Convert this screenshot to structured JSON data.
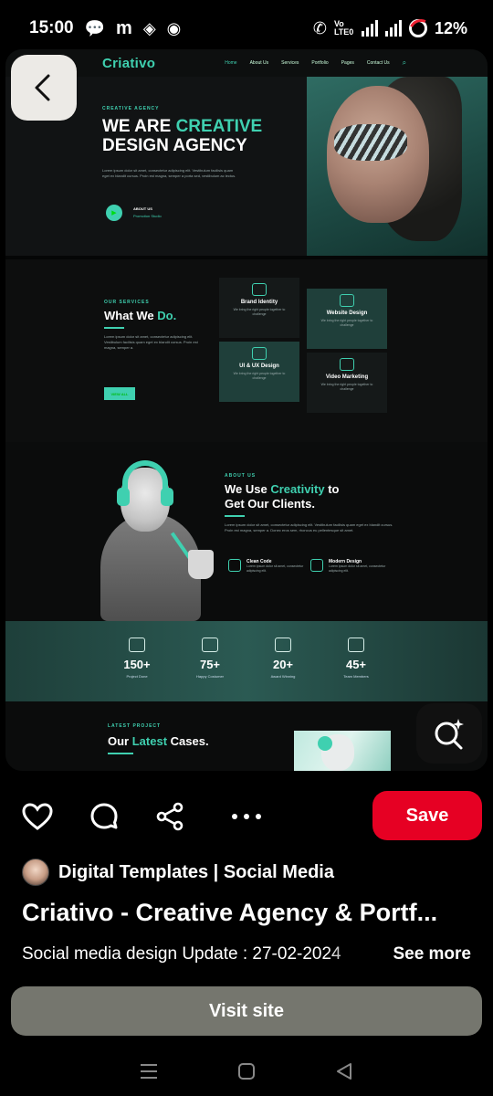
{
  "status_bar": {
    "time": "15:00",
    "left_icons": [
      "chat-bubble-icon",
      "m-icon",
      "discord-icon",
      "whatsapp-icon"
    ],
    "network_label": "Vo LTE0",
    "battery": "12%"
  },
  "pin": {
    "site": {
      "logo": "Criativo",
      "nav_links": [
        "Home",
        "About Us",
        "Services",
        "Portfolio",
        "Pages",
        "Contact Us"
      ],
      "hero": {
        "eyebrow": "CREATIVE AGENCY",
        "title_line1": "WE ARE ",
        "title_accent": "CREATIVE",
        "title_line2": "DESIGN AGENCY",
        "body": "Lorem ipsum dolor sit amet, consectetur adipiscing elit. Vestibulum facilisis quam eget ex blandit cursus. Proin est magna, semper a porta sed, vestibulum ac lectus.",
        "about_label": "ABOUT US",
        "promo_label": "Promotion Studio"
      },
      "services": {
        "eyebrow": "OUR SERVICES",
        "title": "What We ",
        "title_accent": "Do.",
        "body": "Lorem ipsum dolor sit amet, consectetur adipiscing elit. Vestibulum facilisis quam eget ex blandit cursus. Proin est magna, semper a.",
        "button": "VIEW ALL",
        "cards": [
          {
            "title": "Brand Identity",
            "sub": "We bring the right people together to challenge"
          },
          {
            "title": "Website Design",
            "sub": "We bring the right people together to challenge"
          },
          {
            "title": "UI & UX Design",
            "sub": "We bring the right people together to challenge"
          },
          {
            "title": "Video Marketing",
            "sub": "We bring the right people together to challenge"
          }
        ]
      },
      "about": {
        "eyebrow": "ABOUT US",
        "title_pre": "We Use ",
        "title_accent": "Creativity",
        "title_post": " to",
        "title_line2": "Get Our Clients.",
        "body": "Lorem ipsum dolor sit amet, consectetur adipiscing elit. Vestibulum facilisis quam eget ex blandit cursus. Proin est magna, semper a. Donec eros sem, rhoncus eu pellentesque sit amet.",
        "features": [
          {
            "title": "Clean Code",
            "sub": "Lorem ipsum dolor sit amet, consectetur adipiscing elit."
          },
          {
            "title": "Modern Design",
            "sub": "Lorem ipsum dolor sit amet, consectetur adipiscing elit."
          }
        ]
      },
      "stats": [
        {
          "num": "150+",
          "label": "Project Done"
        },
        {
          "num": "75+",
          "label": "Happy Costumer"
        },
        {
          "num": "20+",
          "label": "Award Winning"
        },
        {
          "num": "45+",
          "label": "Team Members"
        }
      ],
      "cases": {
        "eyebrow": "LATEST PROJECT",
        "title": "Our ",
        "title_accent": "Latest",
        "title_post": " Cases."
      }
    }
  },
  "actions": {
    "save_label": "Save"
  },
  "creator": {
    "name": "Digital Templates | Social Media"
  },
  "pin_title": "Criativo - Creative Agency & Portf...",
  "description": "Social media design  Update : 27-02-2024",
  "see_more": "See more",
  "visit_label": "Visit site",
  "colors": {
    "accent": "#3fd0b0",
    "save": "#e60023",
    "visit": "#75766e"
  }
}
